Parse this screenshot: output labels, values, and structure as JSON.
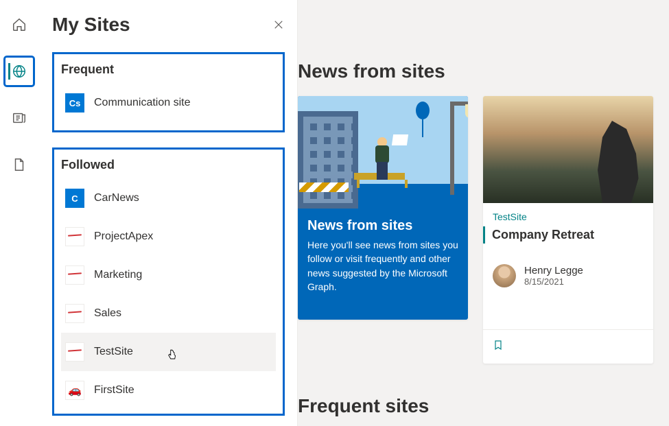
{
  "panel": {
    "title": "My Sites",
    "frequent_label": "Frequent",
    "followed_label": "Followed",
    "frequent": [
      {
        "name": "Communication site",
        "badge": "Cs",
        "icon": "teal"
      }
    ],
    "followed": [
      {
        "name": "CarNews",
        "badge": "C",
        "icon": "teal2"
      },
      {
        "name": "ProjectApex",
        "icon": "wave"
      },
      {
        "name": "Marketing",
        "icon": "wave"
      },
      {
        "name": "Sales",
        "icon": "wave"
      },
      {
        "name": "TestSite",
        "icon": "wave",
        "hovered": true
      },
      {
        "name": "FirstSite",
        "icon": "car",
        "badge": "🚗"
      }
    ]
  },
  "main": {
    "news_heading": "News from sites",
    "frequent_heading": "Frequent sites",
    "blue_card": {
      "title": "News from sites",
      "desc": "Here you'll see news from sites you follow or visit frequently and other news suggested by the Microsoft Graph."
    },
    "post_card": {
      "site": "TestSite",
      "title": "Company Retreat",
      "author": "Henry Legge",
      "date": "8/15/2021"
    }
  },
  "rail": {
    "items": [
      "home",
      "globe",
      "news",
      "file"
    ]
  }
}
